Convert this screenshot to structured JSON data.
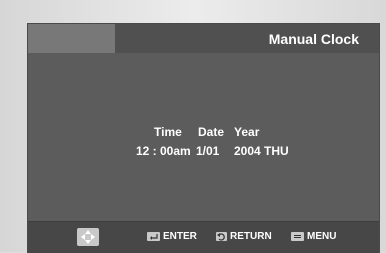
{
  "header": {
    "title": "Manual Clock"
  },
  "clock": {
    "headers": {
      "time": "Time",
      "date": "Date",
      "year": "Year"
    },
    "values": {
      "time": "12 : 00am",
      "date": "1/01",
      "year": "2004 THU"
    }
  },
  "footer": {
    "move_icon": "four-way-arrow-icon",
    "enter_label": "ENTER",
    "enter_icon": "enter-key-icon",
    "return_label": "RETURN",
    "return_icon": "return-arrow-icon",
    "menu_label": "MENU",
    "menu_icon": "menu-key-icon"
  },
  "colors": {
    "screen_bg": "#5c5c5c",
    "title_bar": "#505050",
    "title_accent": "#787878",
    "bottom_bar": "#474747",
    "text": "#ffffff"
  }
}
